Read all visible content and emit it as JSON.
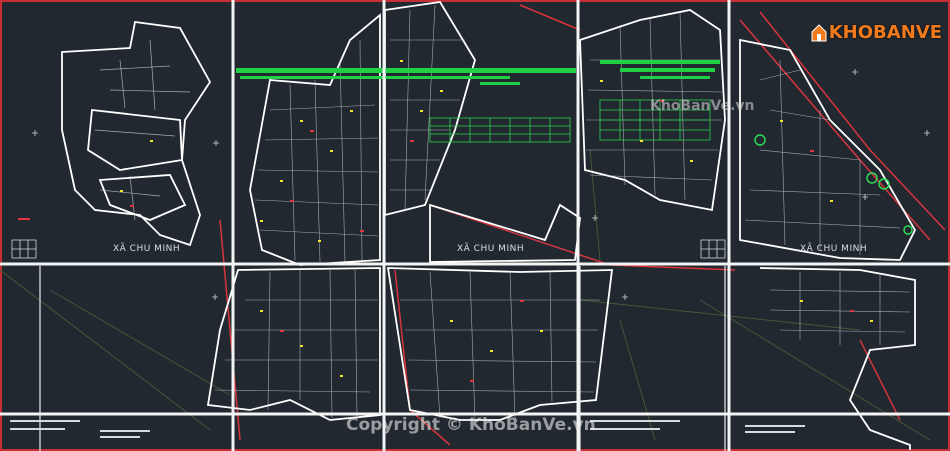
{
  "viewer": {
    "sheet_title_left": "XÃ CHU MINH",
    "sheet_title_center": "XÃ CHU MINH",
    "sheet_title_right": "XÃ CHU MINH",
    "colors": {
      "background": "#222830",
      "parcel": "#ffffff",
      "green": "#22d34a",
      "yellow": "#f2e52a",
      "red": "#e0373f",
      "grid": "#ffffff"
    }
  },
  "brand": {
    "logo_text": "KHOBANVE",
    "watermark_top": "KhoBanVe.vn",
    "watermark_bottom": "Copyright © KhoBanVe.vn"
  }
}
